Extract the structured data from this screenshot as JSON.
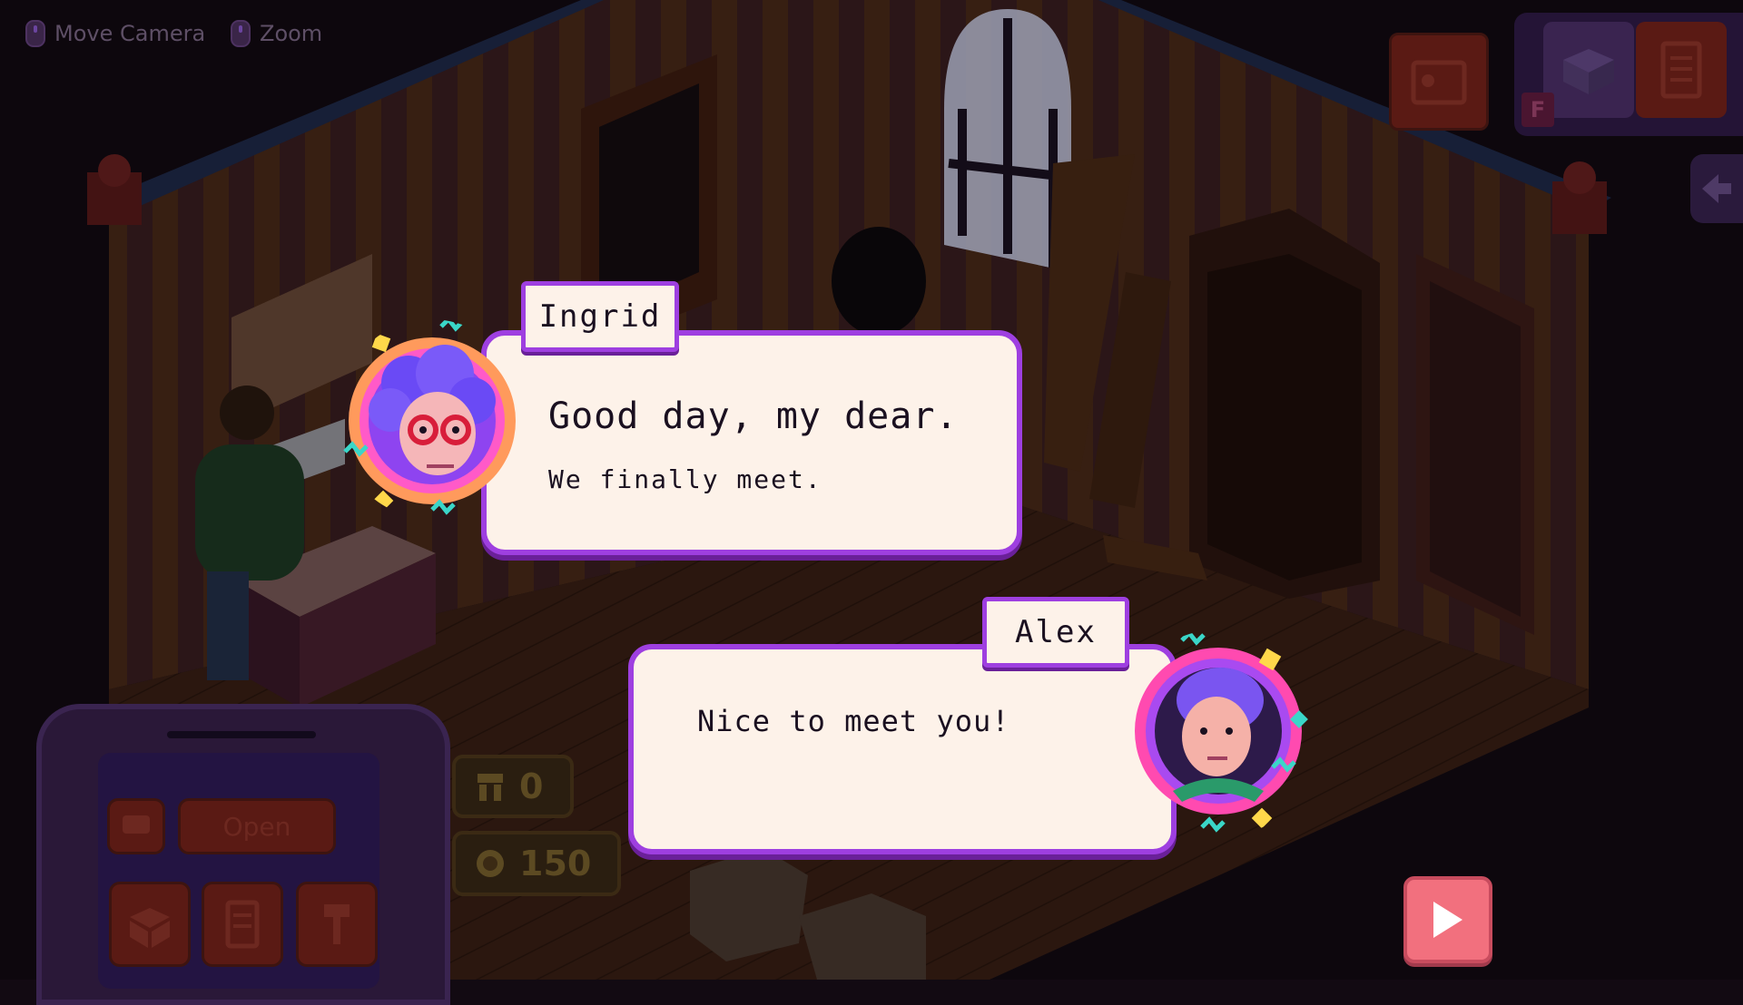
{
  "hints": [
    {
      "icon": "mouse-icon",
      "label": "Move Camera"
    },
    {
      "icon": "mouse-icon",
      "label": "Zoom"
    }
  ],
  "top_right": {
    "inventory_key": "F"
  },
  "dialog": {
    "ingrid": {
      "speaker": "Ingrid",
      "line_large": "Good day, my dear.",
      "line_small": "We finally meet."
    },
    "alex": {
      "speaker": "Alex",
      "line": "Nice to meet you!"
    }
  },
  "hud": {
    "customers_count": "0",
    "coins": "150",
    "open_label": "Open"
  },
  "colors": {
    "dialog_border": "#9e3fe0",
    "dialog_fill": "#fdf2e9",
    "play_button": "#f2707e"
  }
}
